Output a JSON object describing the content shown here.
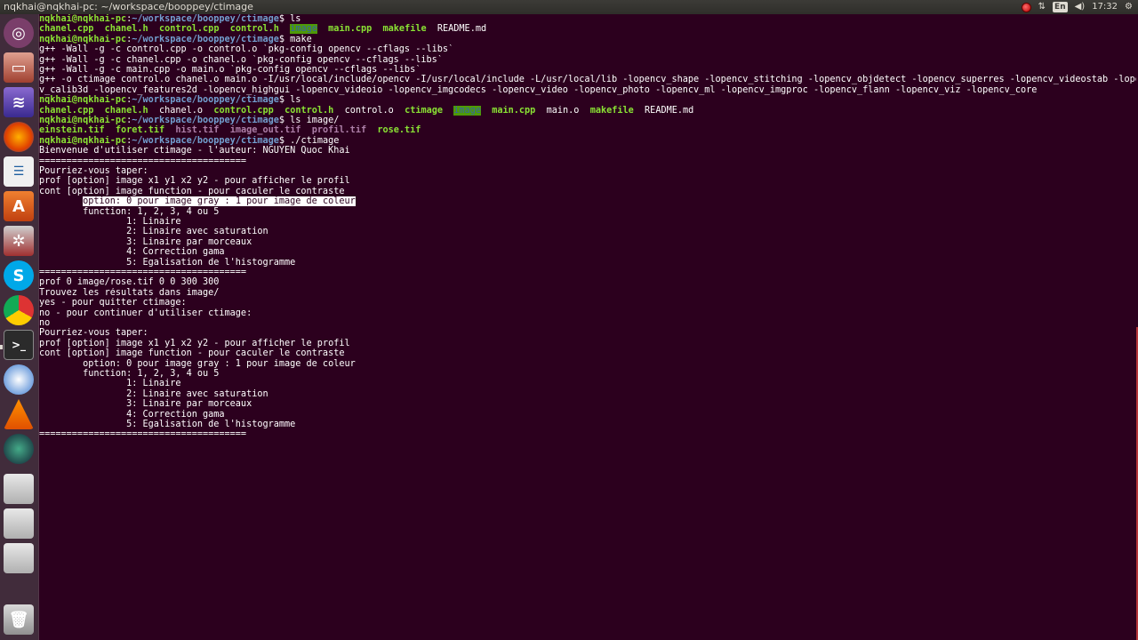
{
  "window": {
    "title": "nqkhai@nqkhai-pc: ~/workspace/booppey/ctimage"
  },
  "indicators": {
    "lang": "En",
    "clock": "17:32"
  },
  "prompt": "nqkhai@nqkhai-pc",
  "path_sep": ":",
  "path": "~/workspace/booppey/ctimage",
  "dollar": "$ ",
  "commands": {
    "ls1": "ls",
    "make": "make",
    "ls2": "ls",
    "lsimage": "ls image/",
    "run": "./ctimage"
  },
  "ls1": {
    "a": "chanel.cpp",
    "b": "chanel.h",
    "c": "control.cpp",
    "d": "control.h",
    "e": "image",
    "f": "main.cpp",
    "g": "makefile",
    "h": "README.md"
  },
  "make_lines": [
    "g++ -Wall -g -c control.cpp -o control.o `pkg-config opencv --cflags --libs`",
    "g++ -Wall -g -c chanel.cpp -o chanel.o `pkg-config opencv --cflags --libs`",
    "g++ -Wall -g -c main.cpp -o main.o `pkg-config opencv --cflags --libs`",
    "g++ -o ctimage control.o chanel.o main.o -I/usr/local/include/opencv -I/usr/local/include -L/usr/local/lib -lopencv_shape -lopencv_stitching -lopencv_objdetect -lopencv_superres -lopencv_videostab -lopenc",
    "v_calib3d -lopencv_features2d -lopencv_highgui -lopencv_videoio -lopencv_imgcodecs -lopencv_video -lopencv_photo -lopencv_ml -lopencv_imgproc -lopencv_flann -lopencv_viz -lopencv_core"
  ],
  "ls2": {
    "a": "chanel.cpp",
    "b": "chanel.h",
    "c": "chanel.o",
    "d": "control.cpp",
    "e": "control.h",
    "f": "control.o",
    "g": "ctimage",
    "h": "image",
    "i": "main.cpp",
    "j": "main.o",
    "k": "makefile",
    "l": "README.md"
  },
  "ls_image": {
    "a": "einstein.tif",
    "b": "foret.tif",
    "c": "hist.tif",
    "d": "image_out.tif",
    "e": "profil.tif",
    "f": "rose.tif"
  },
  "output": {
    "welcome": "Bienvenue d'utiliser ctimage - l'auteur: NGUYEN Quoc Khai",
    "sep": "======================================",
    "menu_title": "Pourriez-vous taper:",
    "menu_prof": "prof [option] image x1 y1 x2 y2 - pour afficher le profil",
    "menu_cont": "cont [option] image function - pour caculer le contraste",
    "menu_indent1": "        ",
    "menu_option": "option: 0 pour image gray : 1 pour image de coleur",
    "menu_function": "        function: 1, 2, 3, 4 ou 5",
    "menu_f1": "                1: Linaire",
    "menu_f2": "                2: Linaire avec saturation",
    "menu_f3": "                3: Linaire par morceaux",
    "menu_f4": "                4: Correction gama",
    "menu_f5": "                5: Egalisation de l'histogramme",
    "menu_option2": "        option: 0 pour image gray : 1 pour image de coleur",
    "user_input": "prof 0 image/rose.tif 0 0 300 300",
    "result": "Trouvez les résultats dans image/",
    "quit": "yes - pour quitter ctimage:",
    "continue": "no - pour continuer d'utiliser ctimage:",
    "answer": "no"
  }
}
